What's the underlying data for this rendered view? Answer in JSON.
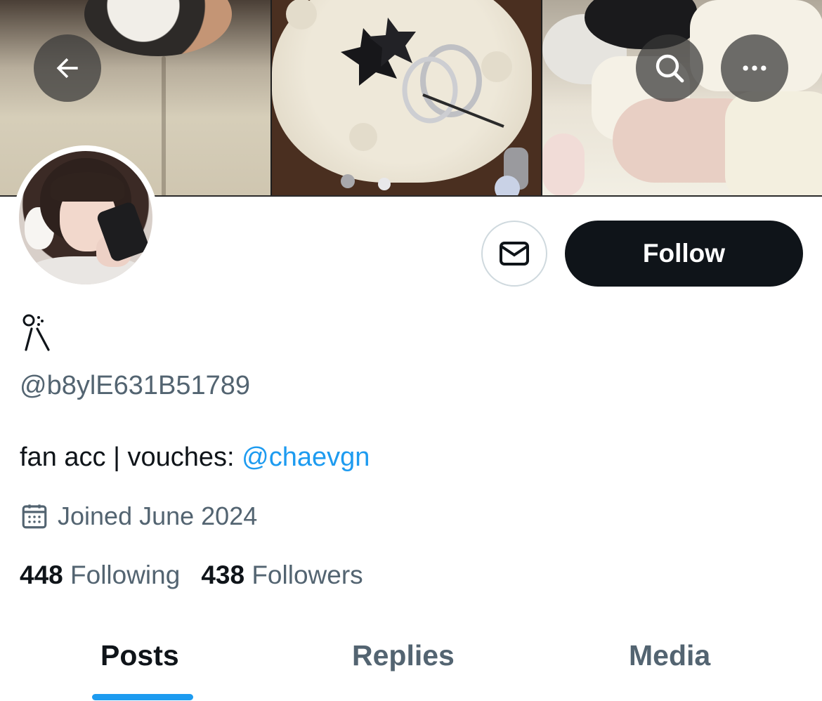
{
  "header": {
    "back_icon": "arrow-left-icon",
    "search_icon": "search-icon",
    "more_icon": "more-horizontal-icon"
  },
  "profile": {
    "display_name_glyph": "ꕤ-style symbol",
    "handle": "@b8ylE631B51789",
    "bio_text": "fan acc | vouches: ",
    "bio_mention": "@chaevgn",
    "joined": "Joined June 2024",
    "following_count": "448",
    "following_label": "Following",
    "followers_count": "438",
    "followers_label": "Followers"
  },
  "actions": {
    "message_icon": "mail-icon",
    "follow_label": "Follow"
  },
  "tabs": [
    {
      "label": "Posts",
      "active": true
    },
    {
      "label": "Replies",
      "active": false
    },
    {
      "label": "Media",
      "active": false
    }
  ],
  "colors": {
    "accent": "#1d9bf0",
    "text_primary": "#0f1419",
    "text_secondary": "#536471",
    "follow_bg": "#0f1419"
  }
}
